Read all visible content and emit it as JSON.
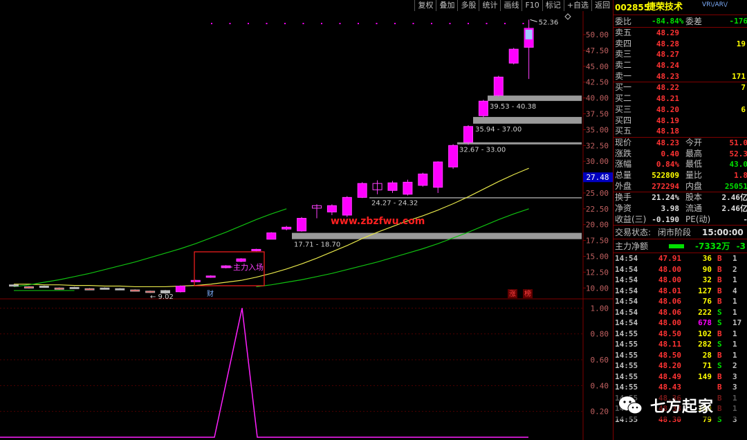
{
  "toolbar": [
    "复权",
    "叠加",
    "多股",
    "统计",
    "画线",
    "F10",
    "标记",
    "+自选",
    "返回"
  ],
  "header": {
    "code": "002855",
    "name": "捷荣技术",
    "flags": "VR\\/AR\\/"
  },
  "orderbook": {
    "weibi_label": "委比",
    "weibi": "-84.84%",
    "weicha_label": "委差",
    "weicha": "-176",
    "asks": [
      {
        "label": "卖五",
        "price": "48.29",
        "vol": ""
      },
      {
        "label": "卖四",
        "price": "48.28",
        "vol": "19"
      },
      {
        "label": "卖三",
        "price": "48.27",
        "vol": ""
      },
      {
        "label": "卖二",
        "price": "48.24",
        "vol": ""
      },
      {
        "label": "卖一",
        "price": "48.23",
        "vol": "171"
      }
    ],
    "bids": [
      {
        "label": "买一",
        "price": "48.22",
        "vol": "7"
      },
      {
        "label": "买二",
        "price": "48.21",
        "vol": ""
      },
      {
        "label": "买三",
        "price": "48.20",
        "vol": "6"
      },
      {
        "label": "买四",
        "price": "48.19",
        "vol": ""
      },
      {
        "label": "买五",
        "price": "48.18",
        "vol": ""
      }
    ]
  },
  "quote": [
    {
      "l1": "现价",
      "v1": "48.23",
      "l2": "今开",
      "v2": "51.0"
    },
    {
      "l1": "涨跌",
      "v1": "0.40",
      "l2": "最高",
      "v2": "52.3"
    },
    {
      "l1": "涨幅",
      "v1": "0.84%",
      "l2": "最低",
      "v2": "43.0"
    },
    {
      "l1": "总量",
      "v1": "522809",
      "l2": "量比",
      "v2": "1.8"
    },
    {
      "l1": "外盘",
      "v1": "272294",
      "l2": "内盘",
      "v2": "25051"
    }
  ],
  "fundamentals": [
    {
      "l1": "换手",
      "v1": "21.24%",
      "l2": "股本",
      "v2": "2.46亿"
    },
    {
      "l1": "净资",
      "v1": "3.98",
      "l2": "流通",
      "v2": "2.46亿"
    },
    {
      "l1": "收益(三)",
      "v1": "-0.190",
      "l2": "PE(动)",
      "v2": "-"
    }
  ],
  "status": {
    "label": "交易状态:",
    "value": "闭市阶段",
    "time": "15:00:00"
  },
  "netflow": {
    "label": "主力净额",
    "value": "-7332万",
    "extra": "-3"
  },
  "ticks": [
    {
      "t": "14:54",
      "p": "47.91",
      "v": "36",
      "d": "B",
      "n": "1"
    },
    {
      "t": "14:54",
      "p": "48.00",
      "v": "90",
      "d": "B",
      "n": "2"
    },
    {
      "t": "14:54",
      "p": "48.00",
      "v": "32",
      "d": "B",
      "n": "1"
    },
    {
      "t": "14:54",
      "p": "48.01",
      "v": "127",
      "d": "B",
      "n": "4"
    },
    {
      "t": "14:54",
      "p": "48.06",
      "v": "76",
      "d": "B",
      "n": "1"
    },
    {
      "t": "14:54",
      "p": "48.06",
      "v": "222",
      "d": "S",
      "n": "1"
    },
    {
      "t": "14:54",
      "p": "48.00",
      "v": "678",
      "d": "S",
      "n": "17"
    },
    {
      "t": "14:55",
      "p": "48.50",
      "v": "102",
      "d": "B",
      "n": "1"
    },
    {
      "t": "14:55",
      "p": "48.11",
      "v": "282",
      "d": "S",
      "n": "1"
    },
    {
      "t": "14:55",
      "p": "48.50",
      "v": "28",
      "d": "B",
      "n": "1"
    },
    {
      "t": "14:55",
      "p": "48.20",
      "v": "71",
      "d": "S",
      "n": "2"
    },
    {
      "t": "14:55",
      "p": "48.49",
      "v": "149",
      "d": "B",
      "n": "3"
    },
    {
      "t": "14:55",
      "p": "48.43",
      "v": "",
      "d": "B",
      "n": "3"
    },
    {
      "t": "14:55",
      "p": "48.36",
      "v": "",
      "d": "B",
      "n": "1"
    },
    {
      "t": "14:55",
      "p": "48.33",
      "v": "189",
      "d": "B",
      "n": "1"
    },
    {
      "t": "14:55",
      "p": "48.30",
      "v": "79",
      "d": "S",
      "n": "3"
    }
  ],
  "watermark": {
    "site": "www.zbzfwu.com",
    "brand": "七方起家"
  },
  "colors": {
    "bull": "#ff00ff",
    "ma1": "#e6e64a",
    "ma2": "#10c010",
    "price_tag": "#0000c0"
  },
  "chart_data": {
    "type": "candlestick",
    "main_axis": {
      "ticks": [
        "50.00",
        "47.50",
        "45.00",
        "42.50",
        "40.00",
        "37.50",
        "35.00",
        "32.50",
        "30.00",
        "27.50",
        "25.00",
        "22.50",
        "20.00",
        "17.50",
        "15.00",
        "12.50",
        "10.00"
      ],
      "range": [
        8.5,
        53.5
      ]
    },
    "current_price_tag": "27.48",
    "max_label": "52.36",
    "min_label": "9.02",
    "candles": [
      {
        "o": 10.3,
        "c": 10.5,
        "h": 10.6,
        "l": 10.2
      },
      {
        "o": 10.2,
        "c": 10.0,
        "h": 10.3,
        "l": 9.9
      },
      {
        "o": 10.2,
        "c": 10.3,
        "h": 10.4,
        "l": 10.1
      },
      {
        "o": 10.0,
        "c": 9.8,
        "h": 10.1,
        "l": 9.7
      },
      {
        "o": 10.0,
        "c": 10.1,
        "h": 10.2,
        "l": 9.9
      },
      {
        "o": 9.9,
        "c": 9.8,
        "h": 10.0,
        "l": 9.7
      },
      {
        "o": 9.9,
        "c": 10.0,
        "h": 10.1,
        "l": 9.8
      },
      {
        "o": 9.8,
        "c": 9.9,
        "h": 10.0,
        "l": 9.7
      },
      {
        "o": 9.7,
        "c": 9.6,
        "h": 9.8,
        "l": 9.5
      },
      {
        "o": 9.5,
        "c": 9.3,
        "h": 9.6,
        "l": 9.2
      },
      {
        "o": 9.2,
        "c": 9.6,
        "h": 9.7,
        "l": 9.0
      },
      {
        "o": 9.4,
        "c": 10.3,
        "h": 10.4,
        "l": 9.3
      },
      {
        "o": 11.1,
        "c": 11.2,
        "h": 11.3,
        "l": 11.0
      },
      {
        "o": 11.7,
        "c": 11.9,
        "h": 12.0,
        "l": 11.6
      },
      {
        "o": 13.2,
        "c": 13.5,
        "h": 13.6,
        "l": 13.1
      },
      {
        "o": 14.2,
        "c": 14.6,
        "h": 14.7,
        "l": 14.1
      },
      {
        "o": 15.9,
        "c": 16.1,
        "h": 16.2,
        "l": 15.8
      },
      {
        "o": 17.7,
        "c": 18.7,
        "h": 18.8,
        "l": 17.7
      },
      {
        "o": 19.3,
        "c": 19.6,
        "h": 19.8,
        "l": 19.1
      },
      {
        "o": 19.0,
        "c": 21.0,
        "h": 21.2,
        "l": 18.9
      },
      {
        "o": 23.0,
        "c": 22.6,
        "h": 23.2,
        "l": 21.0
      },
      {
        "o": 22.0,
        "c": 23.0,
        "h": 23.2,
        "l": 21.5
      },
      {
        "o": 21.5,
        "c": 24.3,
        "h": 24.5,
        "l": 21.2
      },
      {
        "o": 24.3,
        "c": 26.5,
        "h": 26.7,
        "l": 24.2
      },
      {
        "o": 26.5,
        "c": 25.5,
        "h": 27.0,
        "l": 24.8
      },
      {
        "o": 25.4,
        "c": 26.6,
        "h": 26.9,
        "l": 25.0
      },
      {
        "o": 24.8,
        "c": 26.7,
        "h": 27.1,
        "l": 24.6
      },
      {
        "o": 26.2,
        "c": 28.0,
        "h": 28.2,
        "l": 26.0
      },
      {
        "o": 25.9,
        "c": 29.9,
        "h": 30.0,
        "l": 25.0
      },
      {
        "o": 29.1,
        "c": 32.5,
        "h": 32.7,
        "l": 28.8
      },
      {
        "o": 33.0,
        "c": 35.5,
        "h": 35.7,
        "l": 32.6
      },
      {
        "o": 37.2,
        "c": 39.5,
        "h": 39.7,
        "l": 36.9
      },
      {
        "o": 40.4,
        "c": 43.3,
        "h": 43.5,
        "l": 40.2
      },
      {
        "o": 45.5,
        "c": 47.7,
        "h": 47.9,
        "l": 45.3
      },
      {
        "o": 48.0,
        "c": 51.0,
        "h": 52.36,
        "l": 43.0
      }
    ],
    "ma_short": [
      10.6,
      10.6,
      10.5,
      10.5,
      10.4,
      10.4,
      10.3,
      10.3,
      10.2,
      10.2,
      10.2,
      10.3,
      10.4,
      10.6,
      10.9,
      11.2,
      11.7,
      12.3,
      13.0,
      13.8,
      14.7,
      15.7,
      16.7,
      17.8,
      18.8,
      19.7,
      20.6,
      21.4,
      22.3,
      23.3,
      24.4,
      25.6,
      26.8,
      27.9,
      28.9
    ],
    "ma_long": [
      9.6,
      9.6,
      9.6,
      9.6,
      9.6,
      9.6,
      9.6,
      9.6,
      9.5,
      9.5,
      9.4,
      9.4,
      9.5,
      9.6,
      9.7,
      9.9,
      10.2,
      10.5,
      10.9,
      11.3,
      11.8,
      12.3,
      12.9,
      13.5,
      14.1,
      14.8,
      15.5,
      16.2,
      17.0,
      17.9,
      18.8,
      19.8,
      20.8,
      21.7,
      22.5
    ],
    "zones": [
      {
        "label": "17.71 - 18.70",
        "lo": 17.71,
        "hi": 18.7
      },
      {
        "label": "24.27 - 24.32",
        "lo": 24.27,
        "hi": 24.32
      },
      {
        "label": "32.67 - 33.00",
        "lo": 32.67,
        "hi": 33.0
      },
      {
        "label": "35.94 - 37.00",
        "lo": 35.94,
        "hi": 37.0
      },
      {
        "label": "39.53 - 40.38",
        "lo": 39.53,
        "hi": 40.38
      }
    ],
    "entry_label": "主力入场",
    "markers": [
      "财",
      "涨",
      "榜"
    ],
    "sub_axis": {
      "ticks": [
        "1.00",
        "0.80",
        "0.60",
        "0.40",
        "0.20"
      ],
      "range": [
        0,
        1.05
      ]
    },
    "signal": [
      0,
      0,
      0,
      0,
      0,
      0,
      0,
      0,
      0,
      0,
      0,
      0,
      0,
      0,
      0,
      0,
      1,
      0,
      0,
      0,
      0,
      0,
      0,
      0,
      0,
      0,
      0,
      0,
      0,
      0,
      0,
      0,
      0,
      0,
      0
    ]
  }
}
